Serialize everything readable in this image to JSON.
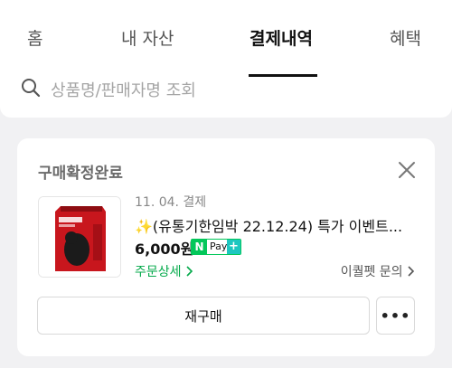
{
  "tabs": [
    {
      "label": "홈"
    },
    {
      "label": "내 자산"
    },
    {
      "label": "결제내역",
      "active": true
    },
    {
      "label": "혜택"
    }
  ],
  "search": {
    "placeholder": "상품명/판매자명 조회",
    "icon": "search-icon"
  },
  "order": {
    "status": "구매확정완료",
    "date": "11. 04. 결제",
    "title": "✨(유통기한임박 22.12.24) 특가 이벤트...",
    "price": "6,000원",
    "pay_badge": {
      "n": "N",
      "text": "Pay",
      "plus": "+"
    },
    "order_detail": "주문상세",
    "seller_inquiry": "이퀄펫 문의",
    "rebuy_label": "재구매",
    "more_label": "•••"
  },
  "colors": {
    "accent_green": "#03a94a",
    "npay_green": "#03c75a",
    "background": "#f1f1f3"
  }
}
